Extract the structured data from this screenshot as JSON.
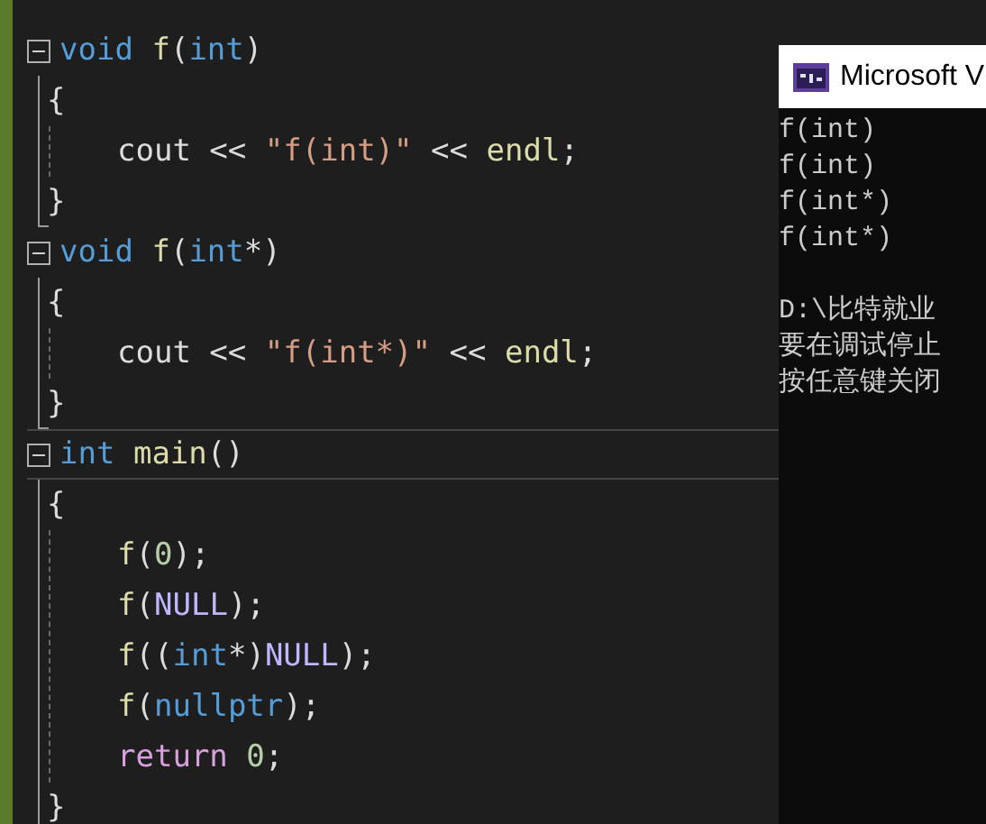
{
  "editor": {
    "functions": [
      {
        "expanded": true,
        "current": false,
        "signature": [
          {
            "kind": "keyword",
            "text": "void"
          },
          {
            "kind": "function",
            "text": " f"
          },
          {
            "kind": "plain",
            "text": "("
          },
          {
            "kind": "keyword",
            "text": "int"
          },
          {
            "kind": "plain",
            "text": ")"
          }
        ],
        "open_brace": "{",
        "body": [
          [
            {
              "kind": "plain",
              "text": "cout << "
            },
            {
              "kind": "string",
              "text": "\"f(int)\""
            },
            {
              "kind": "plain",
              "text": " << "
            },
            {
              "kind": "function",
              "text": "endl"
            },
            {
              "kind": "plain",
              "text": ";"
            }
          ]
        ],
        "close_brace": "}"
      },
      {
        "expanded": true,
        "current": false,
        "signature": [
          {
            "kind": "keyword",
            "text": "void"
          },
          {
            "kind": "function",
            "text": " f"
          },
          {
            "kind": "plain",
            "text": "("
          },
          {
            "kind": "keyword",
            "text": "int"
          },
          {
            "kind": "plain",
            "text": "*)"
          }
        ],
        "open_brace": "{",
        "body": [
          [
            {
              "kind": "plain",
              "text": "cout << "
            },
            {
              "kind": "string",
              "text": "\"f(int*)\""
            },
            {
              "kind": "plain",
              "text": " << "
            },
            {
              "kind": "function",
              "text": "endl"
            },
            {
              "kind": "plain",
              "text": ";"
            }
          ]
        ],
        "close_brace": "}"
      },
      {
        "expanded": true,
        "current": true,
        "signature": [
          {
            "kind": "keyword",
            "text": "int"
          },
          {
            "kind": "function",
            "text": " main"
          },
          {
            "kind": "plain",
            "text": "()"
          }
        ],
        "open_brace": "{",
        "body": [
          [
            {
              "kind": "function",
              "text": "f"
            },
            {
              "kind": "plain",
              "text": "("
            },
            {
              "kind": "number",
              "text": "0"
            },
            {
              "kind": "plain",
              "text": ");"
            }
          ],
          [
            {
              "kind": "function",
              "text": "f"
            },
            {
              "kind": "plain",
              "text": "("
            },
            {
              "kind": "macro",
              "text": "NULL"
            },
            {
              "kind": "plain",
              "text": ");"
            }
          ],
          [
            {
              "kind": "function",
              "text": "f"
            },
            {
              "kind": "plain",
              "text": "(("
            },
            {
              "kind": "keyword",
              "text": "int"
            },
            {
              "kind": "plain",
              "text": "*)"
            },
            {
              "kind": "macro",
              "text": "NULL"
            },
            {
              "kind": "plain",
              "text": ");"
            }
          ],
          [
            {
              "kind": "function",
              "text": "f"
            },
            {
              "kind": "plain",
              "text": "("
            },
            {
              "kind": "keyword",
              "text": "nullptr"
            },
            {
              "kind": "plain",
              "text": ");"
            }
          ],
          [
            {
              "kind": "control",
              "text": "return"
            },
            {
              "kind": "number",
              "text": " 0"
            },
            {
              "kind": "plain",
              "text": ";"
            }
          ]
        ],
        "close_brace": "}"
      }
    ]
  },
  "console": {
    "title": "Microsoft V",
    "blocks": [
      [
        "f(int)",
        "f(int)",
        "f(int*)",
        "f(int*)"
      ],
      [
        "D:\\比特就业",
        "要在调试停止",
        "按任意键关闭"
      ]
    ]
  }
}
